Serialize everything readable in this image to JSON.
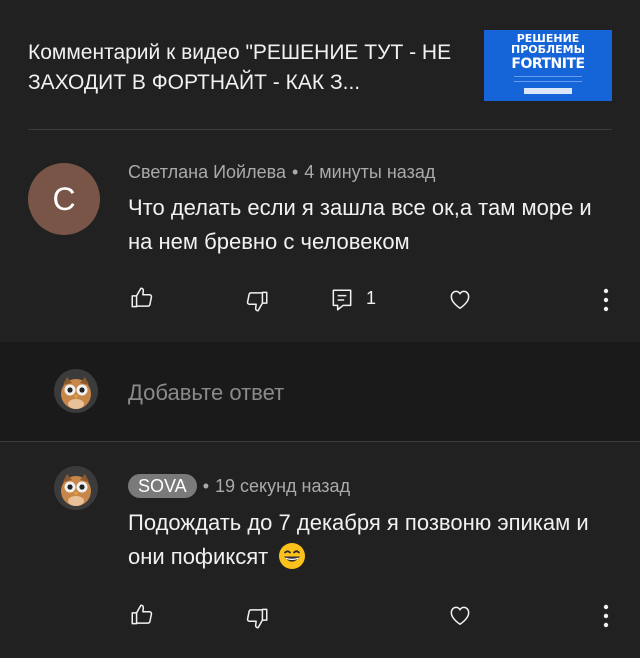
{
  "header": {
    "title": "Комментарий к видео \"РЕШЕНИЕ ТУТ - НЕ ЗАХОДИТ В ФОРТНАЙТ - КАК З...",
    "thumbnail": {
      "line1": "РЕШЕНИЕ",
      "line2": "ПРОБЛЕМЫ",
      "line3": "FORTNITE",
      "bg_color": "#1565d8"
    }
  },
  "comment": {
    "avatar_letter": "С",
    "avatar_color": "#795548",
    "author": "Светлана Иойлева",
    "time": "4 минуты назад",
    "text": "Что делать если я зашла все ок,а там море и на нем бревно с человеком",
    "reply_count": "1"
  },
  "reply_input": {
    "placeholder": "Добавьте ответ"
  },
  "reply": {
    "author": "SOVA",
    "time": "19 секунд назад",
    "text": "Подождать до 7 декабря я позвоню эпикам и они пофиксят",
    "emoji": "grinning-face-icon"
  },
  "icons": {
    "like": "thumbs-up-icon",
    "dislike": "thumbs-down-icon",
    "reply": "reply-comment-icon",
    "heart": "heart-icon",
    "more": "more-vert-icon"
  }
}
